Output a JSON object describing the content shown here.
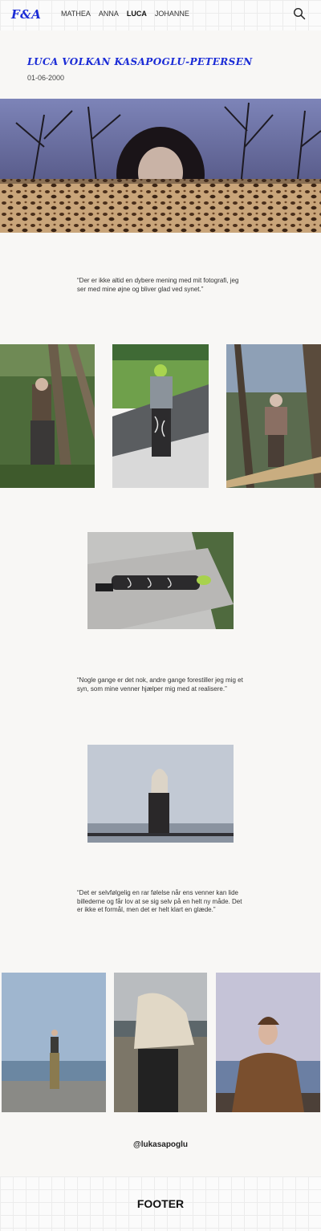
{
  "header": {
    "logo": "F&A",
    "nav": [
      "MATHEA",
      "ANNA",
      "LUCA",
      "JOHANNE"
    ],
    "active": "LUCA",
    "search_icon": "search-icon"
  },
  "profile": {
    "name": "LUCA VOLKAN KASAPOGLU-PETERSEN",
    "date": "01-06-2000"
  },
  "quotes": [
    "“Der er ikke altid en dybere mening med mit fotografi, jeg ser med mine øjne og bliver glad ved synet.”",
    "“Nogle gange er det nok, andre gange forestiller jeg mig et syn, som mine venner hjælper mig med at realisere.”",
    "“Det er selvfølgelig en rar følelse når ens venner kan lide billederne og får lov at se sig selv på en helt ny måde. Det er ikke et formål, men det er helt klart en glæde.”"
  ],
  "handle": "@lukasapoglu",
  "footer": "FOOTER",
  "colors": {
    "accent": "#1a2bd6",
    "background": "#f8f7f5"
  }
}
